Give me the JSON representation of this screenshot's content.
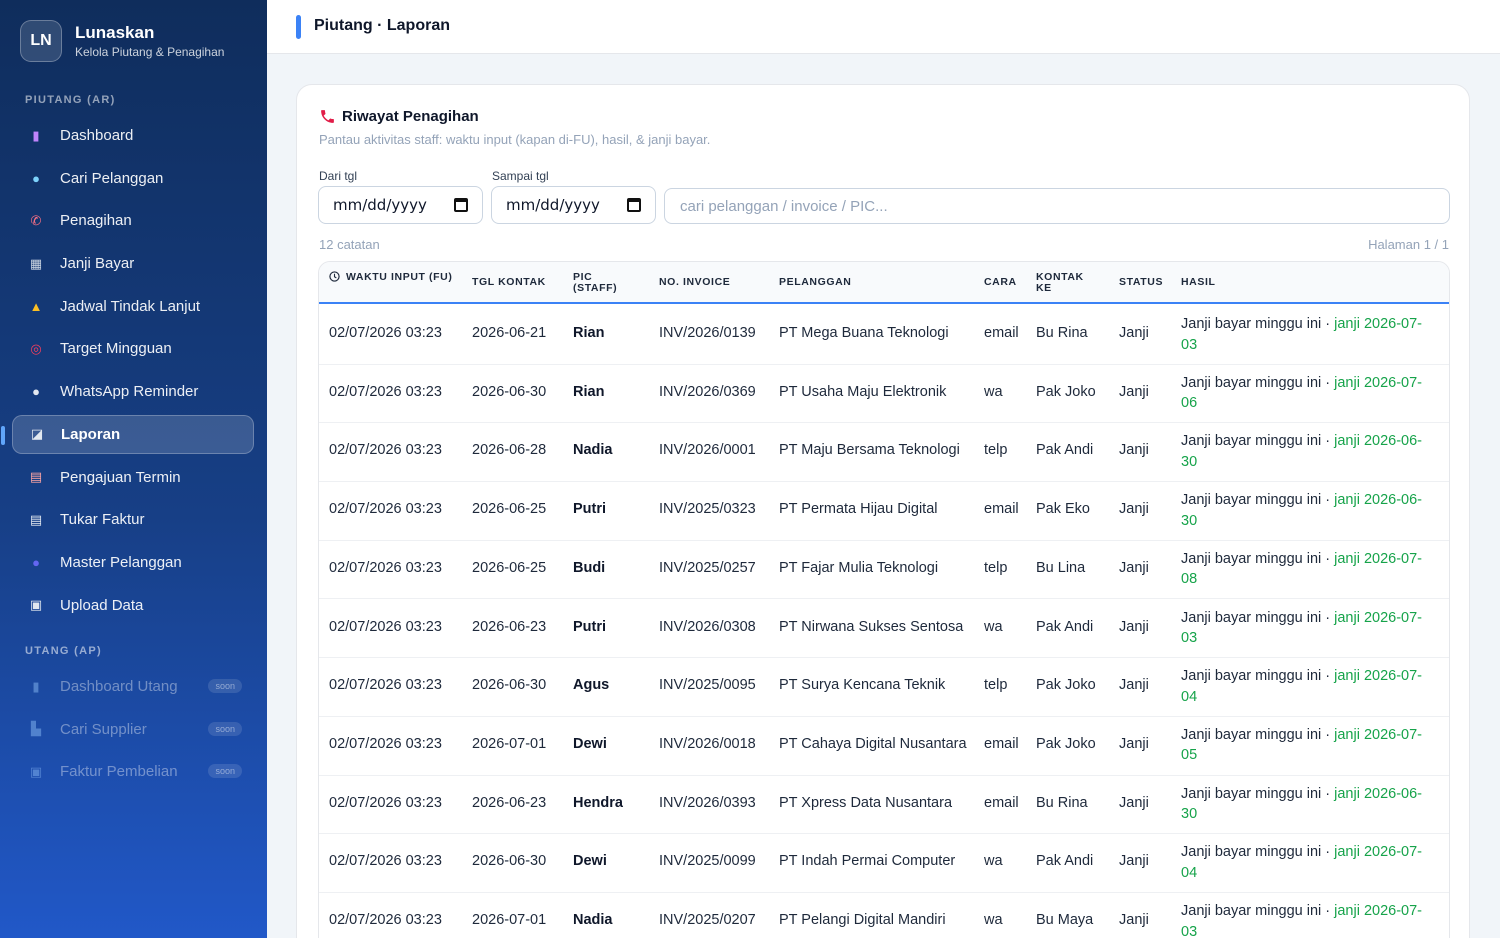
{
  "app": {
    "logo_text": "LN",
    "name": "Lunaskan",
    "subtitle": "Kelola Piutang & Penagihan"
  },
  "sidebar": {
    "section_ar": "PIUTANG (AR)",
    "items_ar": [
      {
        "label": "Dashboard",
        "icon": "bar-chart-icon",
        "glyph": "▮",
        "color": "#c084fc",
        "name": "sidebar-item-dashboard"
      },
      {
        "label": "Cari Pelanggan",
        "icon": "magnifier-icon",
        "glyph": "●",
        "color": "#7dd3fc",
        "name": "sidebar-item-cari-pelanggan"
      },
      {
        "label": "Penagihan",
        "icon": "phone-icon",
        "glyph": "✆",
        "color": "#fb7185",
        "name": "sidebar-item-penagihan"
      },
      {
        "label": "Janji Bayar",
        "icon": "calendar-icon",
        "glyph": "▦",
        "color": "#cbd5e1",
        "name": "sidebar-item-janji-bayar"
      },
      {
        "label": "Jadwal Tindak Lanjut",
        "icon": "bell-icon",
        "glyph": "▲",
        "color": "#fbbf24",
        "name": "sidebar-item-jadwal-tindak-lanjut"
      },
      {
        "label": "Target Mingguan",
        "icon": "target-icon",
        "glyph": "◎",
        "color": "#f43f5e",
        "name": "sidebar-item-target-mingguan"
      },
      {
        "label": "WhatsApp Reminder",
        "icon": "chat-bubble-icon",
        "glyph": "●",
        "color": "#e2e8f0",
        "name": "sidebar-item-whatsapp-reminder"
      },
      {
        "label": "Laporan",
        "icon": "trend-chart-icon",
        "glyph": "◪",
        "color": "#e2e8f0",
        "name": "sidebar-item-laporan",
        "active": true
      },
      {
        "label": "Pengajuan Termin",
        "icon": "document-icon",
        "glyph": "▤",
        "color": "#fca5a5",
        "name": "sidebar-item-pengajuan-termin"
      },
      {
        "label": "Tukar Faktur",
        "icon": "document-list-icon",
        "glyph": "▤",
        "color": "#e2e8f0",
        "name": "sidebar-item-tukar-faktur"
      },
      {
        "label": "Master Pelanggan",
        "icon": "users-icon",
        "glyph": "●",
        "color": "#6366f1",
        "name": "sidebar-item-master-pelanggan"
      },
      {
        "label": "Upload Data",
        "icon": "upload-icon",
        "glyph": "▣",
        "color": "#e2e8f0",
        "name": "sidebar-item-upload-data"
      }
    ],
    "section_ap": "UTANG (AP)",
    "items_ap": [
      {
        "label": "Dashboard Utang",
        "badge": "soon",
        "icon": "bar-chart-icon",
        "glyph": "▮",
        "color": "#93c5fd",
        "name": "sidebar-item-dashboard-utang"
      },
      {
        "label": "Cari Supplier",
        "badge": "soon",
        "icon": "factory-icon",
        "glyph": "▙",
        "color": "#93c5fd",
        "name": "sidebar-item-cari-supplier"
      },
      {
        "label": "Faktur Pembelian",
        "badge": "soon",
        "icon": "receipt-icon",
        "glyph": "▣",
        "color": "#93c5fd",
        "name": "sidebar-item-faktur-pembelian"
      }
    ]
  },
  "header": {
    "title": "Piutang · Laporan"
  },
  "card": {
    "title": "Riwayat Penagihan",
    "subtitle": "Pantau aktivitas staff: waktu input (kapan di-FU), hasil, & janji bayar.",
    "filter_from_label": "Dari tgl",
    "filter_to_label": "Sampai tgl",
    "date_placeholder": "mm/dd/yyyy",
    "search_placeholder": "cari pelanggan / invoice / PIC...",
    "record_count": "12 catatan",
    "pagination": "Halaman 1 / 1"
  },
  "table": {
    "columns": [
      "WAKTU INPUT (FU)",
      "TGL KONTAK",
      "PIC (STAFF)",
      "NO. INVOICE",
      "PELANGGAN",
      "CARA",
      "KONTAK KE",
      "STATUS",
      "HASIL"
    ],
    "rows": [
      {
        "waktu": "02/07/2026 03:23",
        "tgl": "2026-06-21",
        "pic": "Rian",
        "invoice": "INV/2026/0139",
        "pelanggan": "PT Mega Buana Teknologi",
        "cara": "email",
        "kontak": "Bu Rina",
        "status": "Janji",
        "hasil": "Janji bayar minggu ini",
        "janji": "janji 2026-07-03"
      },
      {
        "waktu": "02/07/2026 03:23",
        "tgl": "2026-06-30",
        "pic": "Rian",
        "invoice": "INV/2026/0369",
        "pelanggan": "PT Usaha Maju Elektronik",
        "cara": "wa",
        "kontak": "Pak Joko",
        "status": "Janji",
        "hasil": "Janji bayar minggu ini",
        "janji": "janji 2026-07-06"
      },
      {
        "waktu": "02/07/2026 03:23",
        "tgl": "2026-06-28",
        "pic": "Nadia",
        "invoice": "INV/2026/0001",
        "pelanggan": "PT Maju Bersama Teknologi",
        "cara": "telp",
        "kontak": "Pak Andi",
        "status": "Janji",
        "hasil": "Janji bayar minggu ini",
        "janji": "janji 2026-06-30"
      },
      {
        "waktu": "02/07/2026 03:23",
        "tgl": "2026-06-25",
        "pic": "Putri",
        "invoice": "INV/2025/0323",
        "pelanggan": "PT Permata Hijau Digital",
        "cara": "email",
        "kontak": "Pak Eko",
        "status": "Janji",
        "hasil": "Janji bayar minggu ini",
        "janji": "janji 2026-06-30"
      },
      {
        "waktu": "02/07/2026 03:23",
        "tgl": "2026-06-25",
        "pic": "Budi",
        "invoice": "INV/2025/0257",
        "pelanggan": "PT Fajar Mulia Teknologi",
        "cara": "telp",
        "kontak": "Bu Lina",
        "status": "Janji",
        "hasil": "Janji bayar minggu ini",
        "janji": "janji 2026-07-08"
      },
      {
        "waktu": "02/07/2026 03:23",
        "tgl": "2026-06-23",
        "pic": "Putri",
        "invoice": "INV/2026/0308",
        "pelanggan": "PT Nirwana Sukses Sentosa",
        "cara": "wa",
        "kontak": "Pak Andi",
        "status": "Janji",
        "hasil": "Janji bayar minggu ini",
        "janji": "janji 2026-07-03"
      },
      {
        "waktu": "02/07/2026 03:23",
        "tgl": "2026-06-30",
        "pic": "Agus",
        "invoice": "INV/2025/0095",
        "pelanggan": "PT Surya Kencana Teknik",
        "cara": "telp",
        "kontak": "Pak Joko",
        "status": "Janji",
        "hasil": "Janji bayar minggu ini",
        "janji": "janji 2026-07-04"
      },
      {
        "waktu": "02/07/2026 03:23",
        "tgl": "2026-07-01",
        "pic": "Dewi",
        "invoice": "INV/2026/0018",
        "pelanggan": "PT Cahaya Digital Nusantara",
        "cara": "email",
        "kontak": "Pak Joko",
        "status": "Janji",
        "hasil": "Janji bayar minggu ini",
        "janji": "janji 2026-07-05"
      },
      {
        "waktu": "02/07/2026 03:23",
        "tgl": "2026-06-23",
        "pic": "Hendra",
        "invoice": "INV/2026/0393",
        "pelanggan": "PT Xpress Data Nusantara",
        "cara": "email",
        "kontak": "Bu Rina",
        "status": "Janji",
        "hasil": "Janji bayar minggu ini",
        "janji": "janji 2026-06-30"
      },
      {
        "waktu": "02/07/2026 03:23",
        "tgl": "2026-06-30",
        "pic": "Dewi",
        "invoice": "INV/2025/0099",
        "pelanggan": "PT Indah Permai Computer",
        "cara": "wa",
        "kontak": "Pak Andi",
        "status": "Janji",
        "hasil": "Janji bayar minggu ini",
        "janji": "janji 2026-07-04"
      },
      {
        "waktu": "02/07/2026 03:23",
        "tgl": "2026-07-01",
        "pic": "Nadia",
        "invoice": "INV/2025/0207",
        "pelanggan": "PT Pelangi Digital Mandiri",
        "cara": "wa",
        "kontak": "Bu Maya",
        "status": "Janji",
        "hasil": "Janji bayar minggu ini",
        "janji": "janji 2026-07-03"
      }
    ]
  }
}
